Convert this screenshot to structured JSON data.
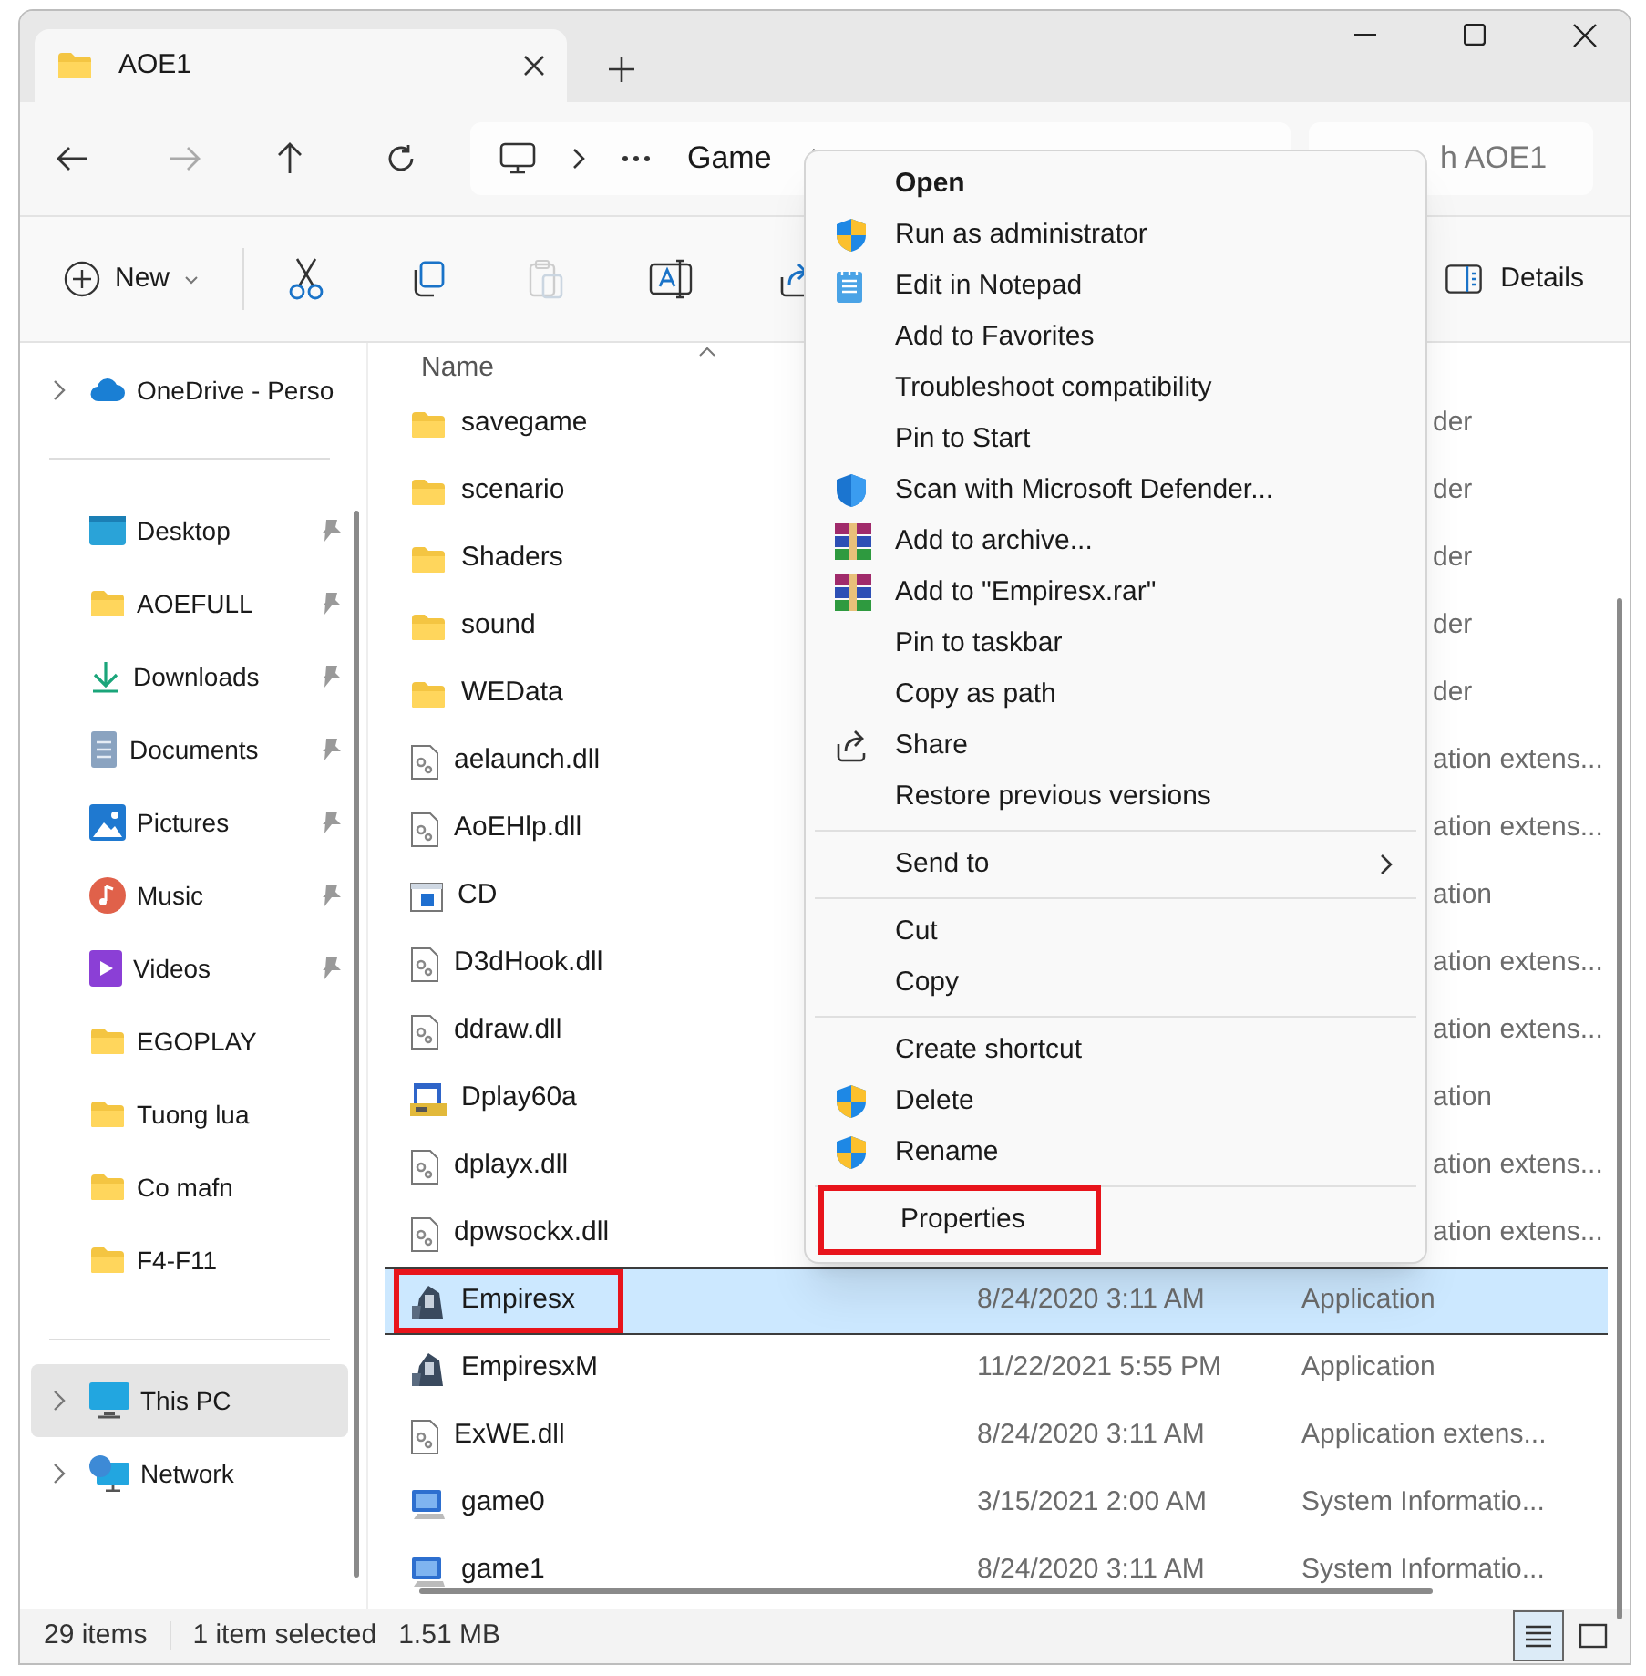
{
  "window": {
    "tab_title": "AOE1"
  },
  "address": {
    "breadcrumb": [
      "Game"
    ],
    "search_placeholder": "h AOE1"
  },
  "toolbar": {
    "new_label": "New",
    "actions": [
      {
        "kind": "cut",
        "disabled": false
      },
      {
        "kind": "copy",
        "disabled": false
      },
      {
        "kind": "paste",
        "disabled": true
      },
      {
        "kind": "rename",
        "disabled": false
      },
      {
        "kind": "share",
        "disabled": false
      }
    ],
    "details_label": "Details"
  },
  "sidebar": {
    "groups": [
      [
        {
          "label": "OneDrive - Perso",
          "kind": "cloud",
          "expandable": true,
          "pinned": false,
          "selected": false
        }
      ],
      [
        {
          "label": "Desktop",
          "kind": "desktop",
          "expandable": false,
          "pinned": true,
          "selected": false
        },
        {
          "label": "AOEFULL",
          "kind": "folder",
          "expandable": false,
          "pinned": true,
          "selected": false
        },
        {
          "label": "Downloads",
          "kind": "download",
          "expandable": false,
          "pinned": true,
          "selected": false
        },
        {
          "label": "Documents",
          "kind": "document",
          "expandable": false,
          "pinned": true,
          "selected": false
        },
        {
          "label": "Pictures",
          "kind": "picture",
          "expandable": false,
          "pinned": true,
          "selected": false
        },
        {
          "label": "Music",
          "kind": "music",
          "expandable": false,
          "pinned": true,
          "selected": false
        },
        {
          "label": "Videos",
          "kind": "video",
          "expandable": false,
          "pinned": true,
          "selected": false
        },
        {
          "label": "EGOPLAY",
          "kind": "folder",
          "expandable": false,
          "pinned": false,
          "selected": false
        },
        {
          "label": "Tuong lua",
          "kind": "folder",
          "expandable": false,
          "pinned": false,
          "selected": false
        },
        {
          "label": "Co mafn",
          "kind": "folder",
          "expandable": false,
          "pinned": false,
          "selected": false
        },
        {
          "label": "F4-F11",
          "kind": "folder",
          "expandable": false,
          "pinned": false,
          "selected": false
        }
      ],
      [
        {
          "label": "This PC",
          "kind": "pc",
          "expandable": true,
          "pinned": false,
          "selected": true
        },
        {
          "label": "Network",
          "kind": "network",
          "expandable": true,
          "pinned": false,
          "selected": false
        }
      ]
    ]
  },
  "file_list": {
    "columns": [
      "Name"
    ],
    "rows": [
      {
        "name": "savegame",
        "kind": "folder",
        "type": "der",
        "selected": false,
        "annotated": false
      },
      {
        "name": "scenario",
        "kind": "folder",
        "type": "der",
        "selected": false,
        "annotated": false
      },
      {
        "name": "Shaders",
        "kind": "folder",
        "type": "der",
        "selected": false,
        "annotated": false
      },
      {
        "name": "sound",
        "kind": "folder",
        "type": "der",
        "selected": false,
        "annotated": false
      },
      {
        "name": "WEData",
        "kind": "folder",
        "type": "der",
        "selected": false,
        "annotated": false
      },
      {
        "name": "aelaunch.dll",
        "kind": "dll",
        "type": "ation extens...",
        "selected": false,
        "annotated": false
      },
      {
        "name": "AoEHlp.dll",
        "kind": "dll",
        "type": "ation extens...",
        "selected": false,
        "annotated": false
      },
      {
        "name": "CD",
        "kind": "app",
        "type": "ation",
        "selected": false,
        "annotated": false
      },
      {
        "name": "D3dHook.dll",
        "kind": "dll",
        "type": "ation extens...",
        "selected": false,
        "annotated": false
      },
      {
        "name": "ddraw.dll",
        "kind": "dll",
        "type": "ation extens...",
        "selected": false,
        "annotated": false
      },
      {
        "name": "Dplay60a",
        "kind": "setup",
        "type": "ation",
        "selected": false,
        "annotated": false
      },
      {
        "name": "dplayx.dll",
        "kind": "dll",
        "type": "ation extens...",
        "selected": false,
        "annotated": false
      },
      {
        "name": "dpwsockx.dll",
        "kind": "dll",
        "type": "ation extens...",
        "selected": false,
        "annotated": false
      },
      {
        "name": "Empiresx",
        "kind": "game",
        "date": "8/24/2020 3:11 AM",
        "type": "Application",
        "selected": true,
        "annotated": true
      },
      {
        "name": "EmpiresxM",
        "kind": "game",
        "date": "11/22/2021 5:55 PM",
        "type": "Application",
        "selected": false,
        "annotated": false
      },
      {
        "name": "ExWE.dll",
        "kind": "dll",
        "date": "8/24/2020 3:11 AM",
        "type": "Application extens...",
        "selected": false,
        "annotated": false
      },
      {
        "name": "game0",
        "kind": "sysinfo",
        "date": "3/15/2021 2:00 AM",
        "type": "System Informatio...",
        "selected": false,
        "annotated": false
      },
      {
        "name": "game1",
        "kind": "sysinfo",
        "date": "8/24/2020 3:11 AM",
        "type": "System Informatio...",
        "selected": false,
        "annotated": false
      }
    ]
  },
  "context_menu": {
    "groups": [
      [
        {
          "label": "Open",
          "kind": "plain",
          "bold": true,
          "submenu": false,
          "annotated": false
        },
        {
          "label": "Run as administrator",
          "kind": "shield",
          "bold": false,
          "submenu": false,
          "annotated": false
        },
        {
          "label": "Edit in Notepad",
          "kind": "notepad",
          "bold": false,
          "submenu": false,
          "annotated": false
        },
        {
          "label": "Add to Favorites",
          "kind": "plain",
          "bold": false,
          "submenu": false,
          "annotated": false
        },
        {
          "label": "Troubleshoot compatibility",
          "kind": "plain",
          "bold": false,
          "submenu": false,
          "annotated": false
        },
        {
          "label": "Pin to Start",
          "kind": "plain",
          "bold": false,
          "submenu": false,
          "annotated": false
        },
        {
          "label": "Scan with Microsoft Defender...",
          "kind": "defender",
          "bold": false,
          "submenu": false,
          "annotated": false
        },
        {
          "label": "Add to archive...",
          "kind": "archive",
          "bold": false,
          "submenu": false,
          "annotated": false
        },
        {
          "label": "Add to \"Empiresx.rar\"",
          "kind": "archive",
          "bold": false,
          "submenu": false,
          "annotated": false
        },
        {
          "label": "Pin to taskbar",
          "kind": "plain",
          "bold": false,
          "submenu": false,
          "annotated": false
        },
        {
          "label": "Copy as path",
          "kind": "plain",
          "bold": false,
          "submenu": false,
          "annotated": false
        },
        {
          "label": "Share",
          "kind": "share",
          "bold": false,
          "submenu": false,
          "annotated": false
        },
        {
          "label": "Restore previous versions",
          "kind": "plain",
          "bold": false,
          "submenu": false,
          "annotated": false
        }
      ],
      [
        {
          "label": "Send to",
          "kind": "plain",
          "bold": false,
          "submenu": true,
          "annotated": false
        }
      ],
      [
        {
          "label": "Cut",
          "kind": "plain",
          "bold": false,
          "submenu": false,
          "annotated": false
        },
        {
          "label": "Copy",
          "kind": "plain",
          "bold": false,
          "submenu": false,
          "annotated": false
        }
      ],
      [
        {
          "label": "Create shortcut",
          "kind": "plain",
          "bold": false,
          "submenu": false,
          "annotated": false
        },
        {
          "label": "Delete",
          "kind": "shield",
          "bold": false,
          "submenu": false,
          "annotated": false
        },
        {
          "label": "Rename",
          "kind": "shield",
          "bold": false,
          "submenu": false,
          "annotated": false
        }
      ],
      [
        {
          "label": "Properties",
          "kind": "plain",
          "bold": false,
          "submenu": false,
          "annotated": true
        }
      ]
    ]
  },
  "status_bar": {
    "item_count": "29 items",
    "selection": "1 item selected",
    "size": "1.51 MB",
    "views": [
      {
        "kind": "details",
        "selected": true
      },
      {
        "kind": "tiles",
        "selected": false
      }
    ]
  }
}
